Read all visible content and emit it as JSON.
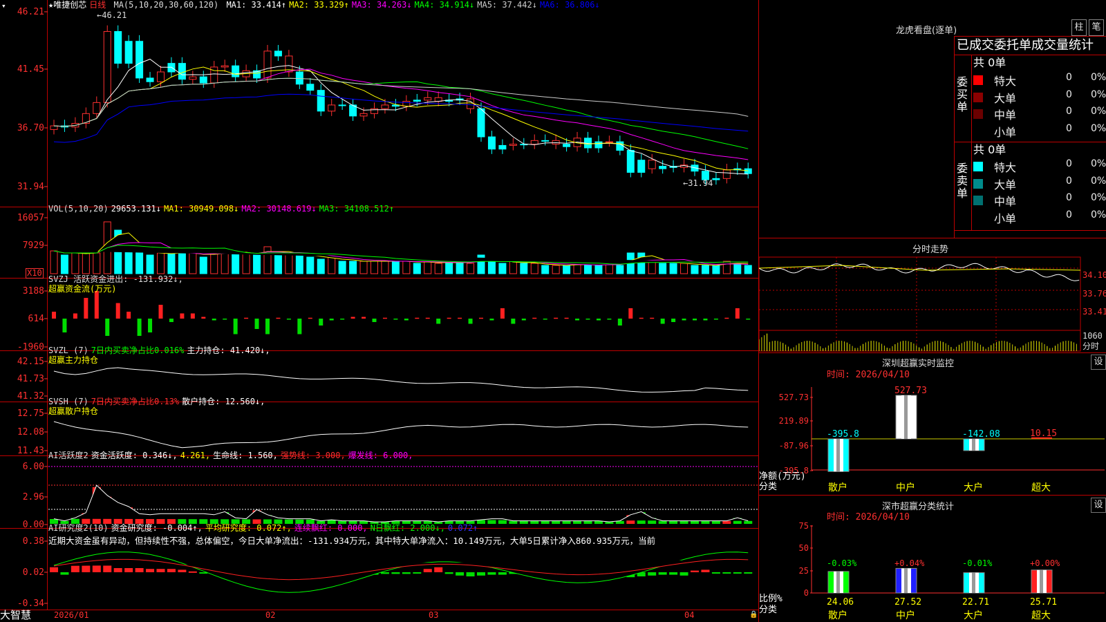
{
  "app": {
    "brand": "大智慧"
  },
  "main": {
    "title_prefix": "★唯捷创芯",
    "period": "日线",
    "ma_header": {
      "label": "MA(5,10,20,30,60,120)",
      "items": [
        {
          "text": "MA1: 33.414↑",
          "color": "#ffffff"
        },
        {
          "text": "MA2: 33.329↑",
          "color": "#ffff00"
        },
        {
          "text": "MA3: 34.263↓",
          "color": "#ff00ff"
        },
        {
          "text": "MA4: 34.914↓",
          "color": "#00ff00"
        },
        {
          "text": "MA5: 37.442↓",
          "color": "#cccccc"
        },
        {
          "text": "MA6: 36.806↓",
          "color": "#0000ff"
        }
      ]
    },
    "y_ticks": [
      "46.21",
      "41.45",
      "36.70",
      "31.94"
    ],
    "hi_label": "46.21",
    "lo_label": "31.94"
  },
  "vol": {
    "header": [
      {
        "text": "VOL(5,10,20)",
        "color": "#dddddd"
      },
      {
        "text": "29653.131↓",
        "color": "#ffffff"
      },
      {
        "text": "MA1: 30949.098↓",
        "color": "#ffff00"
      },
      {
        "text": "MA2: 30148.619↓",
        "color": "#ff00ff"
      },
      {
        "text": "MA3: 34108.512↑",
        "color": "#00ff00"
      }
    ],
    "y_ticks": [
      "16057",
      "7929"
    ],
    "unit": "X10"
  },
  "svzj": {
    "header": [
      {
        "text": "SVZJ  活跃资金进出: -131.932↓,",
        "color": "#dddddd"
      }
    ],
    "line2": "超赢资金流(万元)",
    "y_ticks": [
      "3188",
      "614",
      "-1960"
    ]
  },
  "svzl": {
    "header": [
      {
        "text": "SVZL (7)",
        "color": "#dddddd"
      },
      {
        "text": "7日内买卖净占比0.016%",
        "color": "#00ff00"
      },
      {
        "text": "主力持仓: 41.420↓,",
        "color": "#ffffff"
      }
    ],
    "line2": "超赢主力持仓",
    "y_ticks": [
      "42.15",
      "41.73",
      "41.32"
    ]
  },
  "svsh": {
    "header": [
      {
        "text": "SVSH (7)",
        "color": "#dddddd"
      },
      {
        "text": "7日内买卖净占比0.13%",
        "color": "#ff3030"
      },
      {
        "text": "散户持仓: 12.560↓,",
        "color": "#ffffff"
      }
    ],
    "line2": "超赢散户持仓",
    "y_ticks": [
      "12.75",
      "12.08",
      "11.43"
    ]
  },
  "ai1": {
    "header": [
      {
        "text": "AI活跃度2",
        "color": "#dddddd"
      },
      {
        "text": "资金活跃度: 0.346↓,",
        "color": "#ffffff"
      },
      {
        "text": "4.261,",
        "color": "#ffff00"
      },
      {
        "text": "生命线: 1.560,",
        "color": "#ffffff"
      },
      {
        "text": "强势线: 3.000,",
        "color": "#ff3030"
      },
      {
        "text": "爆发线: 6.000,",
        "color": "#ff00ff"
      }
    ],
    "y_ticks": [
      "6.00",
      "2.96",
      "0.00"
    ]
  },
  "ai2": {
    "header": [
      {
        "text": "AI研究度2(10)",
        "color": "#dddddd"
      },
      {
        "text": "资金研究度: -0.004↑,",
        "color": "#ffffff"
      },
      {
        "text": "平均研究度: 0.072↑,",
        "color": "#ffff00"
      },
      {
        "text": "连续飘红: 0.000,",
        "color": "#ff00ff"
      },
      {
        "text": "N日飘红: 2.000↓,",
        "color": "#00ff00"
      },
      {
        "text": "0.072↑",
        "color": "#3030ff"
      }
    ],
    "line2": "近期大资金虽有异动，但持续性不强，总体偏空，今日大单净流出：-131.934万元，其中特大单净流入：10.149万元，大单5日累计净入860.935万元，当前",
    "y_ticks": [
      "0.38",
      "0.02",
      "-0.34"
    ]
  },
  "x_axis": [
    "2026/01",
    "02",
    "03",
    "04"
  ],
  "right": {
    "longhu": {
      "title": "龙虎看盘(逐单)",
      "btn1": "柱",
      "btn2": "笔",
      "subtitle": "已成交委托单成交量统计"
    },
    "buy": {
      "side": "委买单",
      "total": "共 0单",
      "rows": [
        {
          "name": "特大",
          "count": "0",
          "pct": "0%",
          "color": "#ff0000"
        },
        {
          "name": "大单",
          "count": "0",
          "pct": "0%",
          "color": "#8b0000"
        },
        {
          "name": "中单",
          "count": "0",
          "pct": "0%",
          "color": "#6b0000"
        },
        {
          "name": "小单",
          "count": "0",
          "pct": "0%",
          "color": ""
        }
      ]
    },
    "sell": {
      "side": "委卖单",
      "total": "共 0单",
      "rows": [
        {
          "name": "特大",
          "count": "0",
          "pct": "0%",
          "color": "#00ffff"
        },
        {
          "name": "大单",
          "count": "0",
          "pct": "0%",
          "color": "#008b8b"
        },
        {
          "name": "中单",
          "count": "0",
          "pct": "0%",
          "color": "#007070"
        },
        {
          "name": "小单",
          "count": "0",
          "pct": "0%",
          "color": ""
        }
      ]
    },
    "intraday": {
      "title": "分时走势",
      "y_ticks": [
        "34.10",
        "33.76",
        "33.41"
      ],
      "vol_tick": "1060",
      "vol_label": "分时"
    },
    "monitor": {
      "title": "深圳超赢实时监控",
      "gear": "设",
      "date_label": "时间: 2026/04/10",
      "y_ticks": [
        "527.73",
        "219.89",
        "-87.96",
        "-395.8"
      ],
      "axis_label": "净额(万元)",
      "cat_label": "分类"
    },
    "stats": {
      "title": "深市超赢分类统计",
      "gear": "设",
      "date_label": "时间: 2026/04/10",
      "y_ticks": [
        "75",
        "50",
        "25",
        "0"
      ],
      "axis_label": "比例%",
      "cat_label": "分类"
    }
  },
  "chart_data": [
    {
      "type": "bar",
      "title": "深圳超赢实时监控",
      "ylabel": "净额(万元)",
      "categories": [
        "散户",
        "中户",
        "大户",
        "超大"
      ],
      "values": [
        -395.8,
        527.73,
        -142.08,
        10.15
      ],
      "ylim": [
        -395.8,
        527.73
      ]
    },
    {
      "type": "bar",
      "title": "深市超赢分类统计",
      "ylabel": "比例%",
      "categories": [
        "散户",
        "中户",
        "大户",
        "超大"
      ],
      "values": [
        24.06,
        27.52,
        22.71,
        25.71
      ],
      "changes": [
        "-0.03%",
        "+0.04%",
        "-0.01%",
        "+0.00%"
      ],
      "ylim": [
        0,
        75
      ]
    }
  ]
}
